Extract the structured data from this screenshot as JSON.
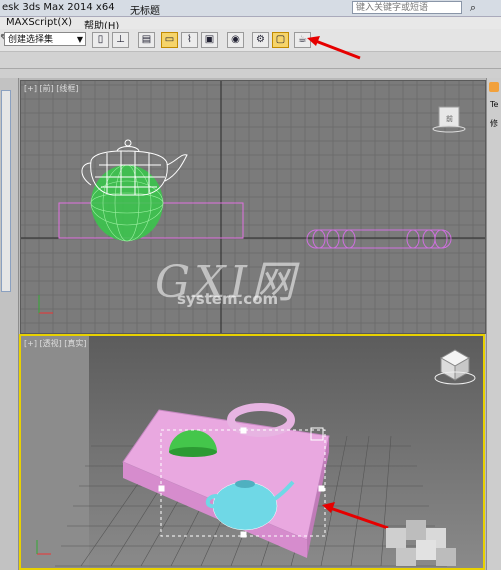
{
  "titlebar": {
    "app_title": "esk 3ds Max  2014 x64",
    "doc_title": "无标题",
    "search_placeholder": "键入关键字或短语",
    "search_icon": "binoculars-icon"
  },
  "menubar": {
    "items": [
      "MAXScript(X)",
      "帮助(H)"
    ]
  },
  "toolbar": {
    "selection_set_value": "创建选择集",
    "buttons": [
      {
        "icon": "mirror-icon",
        "glyph": "▯"
      },
      {
        "icon": "align-icon",
        "glyph": "⊥"
      },
      {
        "icon": "layer-manager-icon",
        "glyph": "▤"
      },
      {
        "icon": "graphite-ribbon-icon",
        "glyph": "▭"
      },
      {
        "icon": "curve-editor-icon",
        "glyph": "⌇"
      },
      {
        "icon": "schematic-view-icon",
        "glyph": "▣"
      },
      {
        "icon": "material-editor-icon",
        "glyph": "◉"
      },
      {
        "icon": "render-setup-icon",
        "glyph": "⚙"
      },
      {
        "icon": "rendered-frame-icon",
        "glyph": "▢"
      },
      {
        "icon": "render-production-icon",
        "glyph": "☕"
      }
    ],
    "highlight_color": "#f6d46a",
    "annotation_arrow_color": "#e60000"
  },
  "viewports": {
    "top_label": "[+] [前] [线框]",
    "persp_label": "[+] [透视] [真实]",
    "active_border_color": "#e8d100",
    "viewcube_top_label": "前"
  },
  "right_panel": {
    "tab1": "Te",
    "tab2": "修"
  },
  "watermark": {
    "brand": "GXI网",
    "site": "system.com"
  }
}
